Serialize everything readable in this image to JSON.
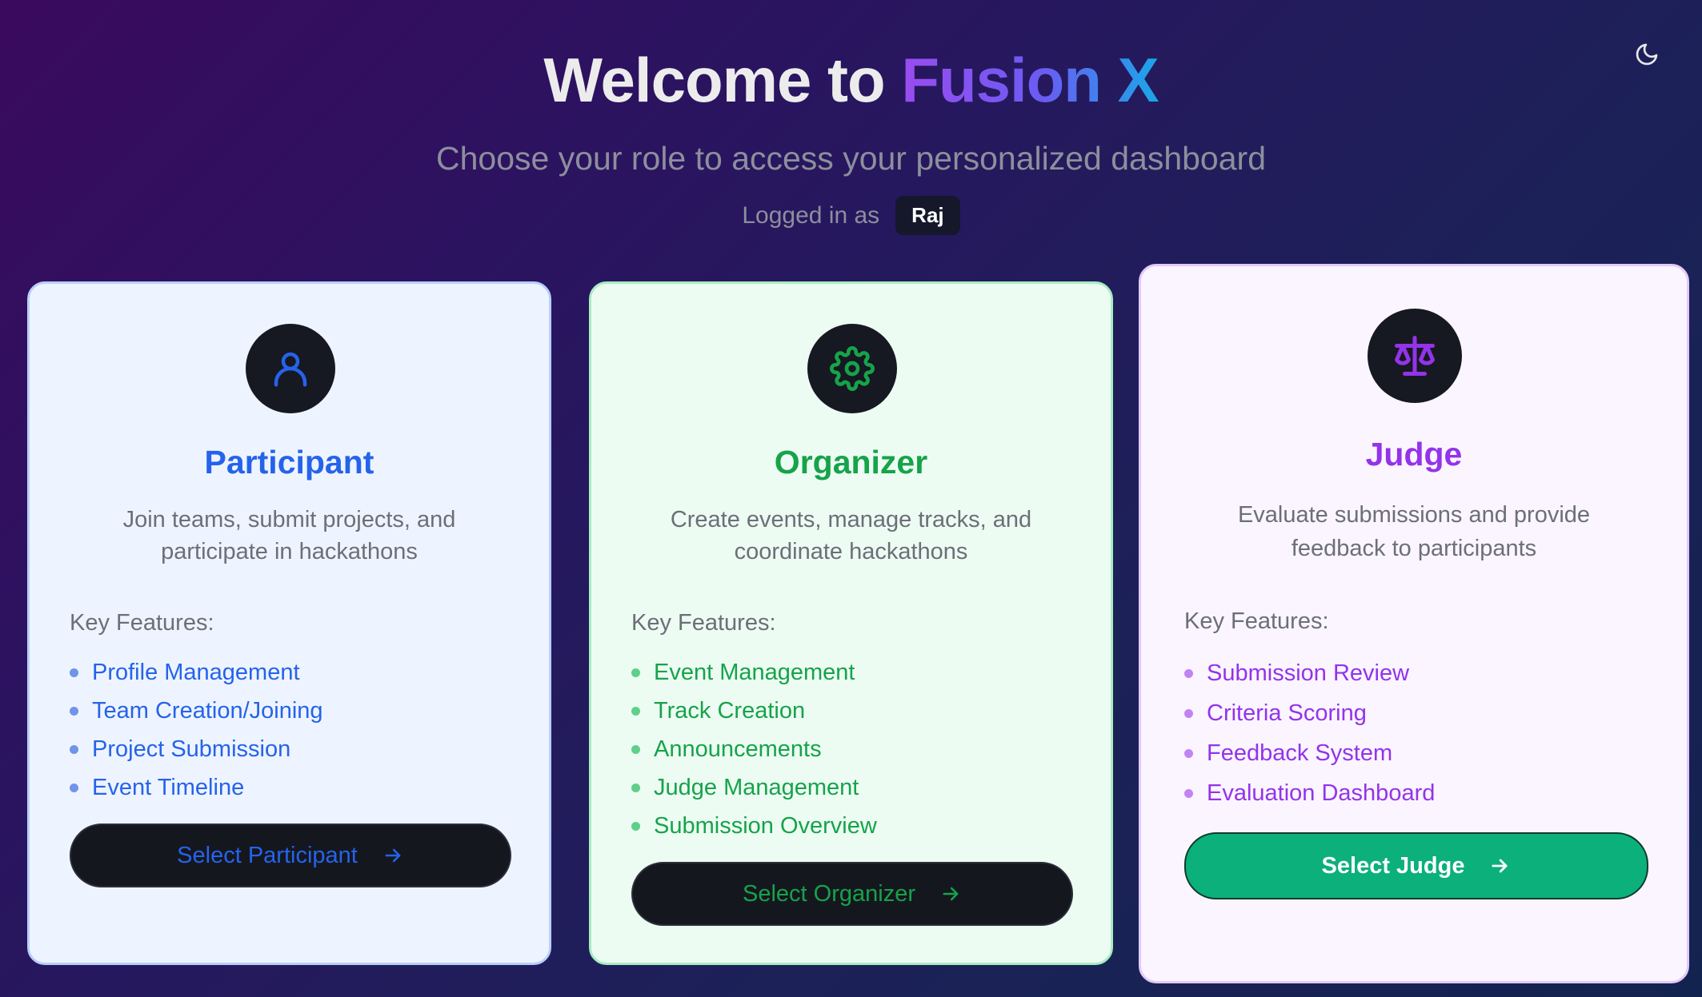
{
  "header": {
    "title_prefix": "Welcome to",
    "title_brand": "Fusion X",
    "subtitle": "Choose your role to access your personalized dashboard",
    "logged_in_label": "Logged in as",
    "username": "Raj"
  },
  "theme_toggle_icon": "moon-icon",
  "colors": {
    "participant_accent": "#2563eb",
    "organizer_accent": "#16a34a",
    "judge_accent": "#9333ea",
    "judge_button_bg": "#0bb07a"
  },
  "roles": [
    {
      "id": "participant",
      "icon": "user-icon",
      "title": "Participant",
      "description": "Join teams, submit projects, and participate in hackathons",
      "features_label": "Key Features:",
      "features": [
        "Profile Management",
        "Team Creation/Joining",
        "Project Submission",
        "Event Timeline"
      ],
      "button_label": "Select Participant"
    },
    {
      "id": "organizer",
      "icon": "gear-icon",
      "title": "Organizer",
      "description": "Create events, manage tracks, and coordinate hackathons",
      "features_label": "Key Features:",
      "features": [
        "Event Management",
        "Track Creation",
        "Announcements",
        "Judge Management",
        "Submission Overview"
      ],
      "button_label": "Select Organizer"
    },
    {
      "id": "judge",
      "icon": "scale-icon",
      "title": "Judge",
      "description": "Evaluate submissions and provide feedback to participants",
      "features_label": "Key Features:",
      "features": [
        "Submission Review",
        "Criteria Scoring",
        "Feedback System",
        "Evaluation Dashboard"
      ],
      "button_label": "Select Judge"
    }
  ]
}
